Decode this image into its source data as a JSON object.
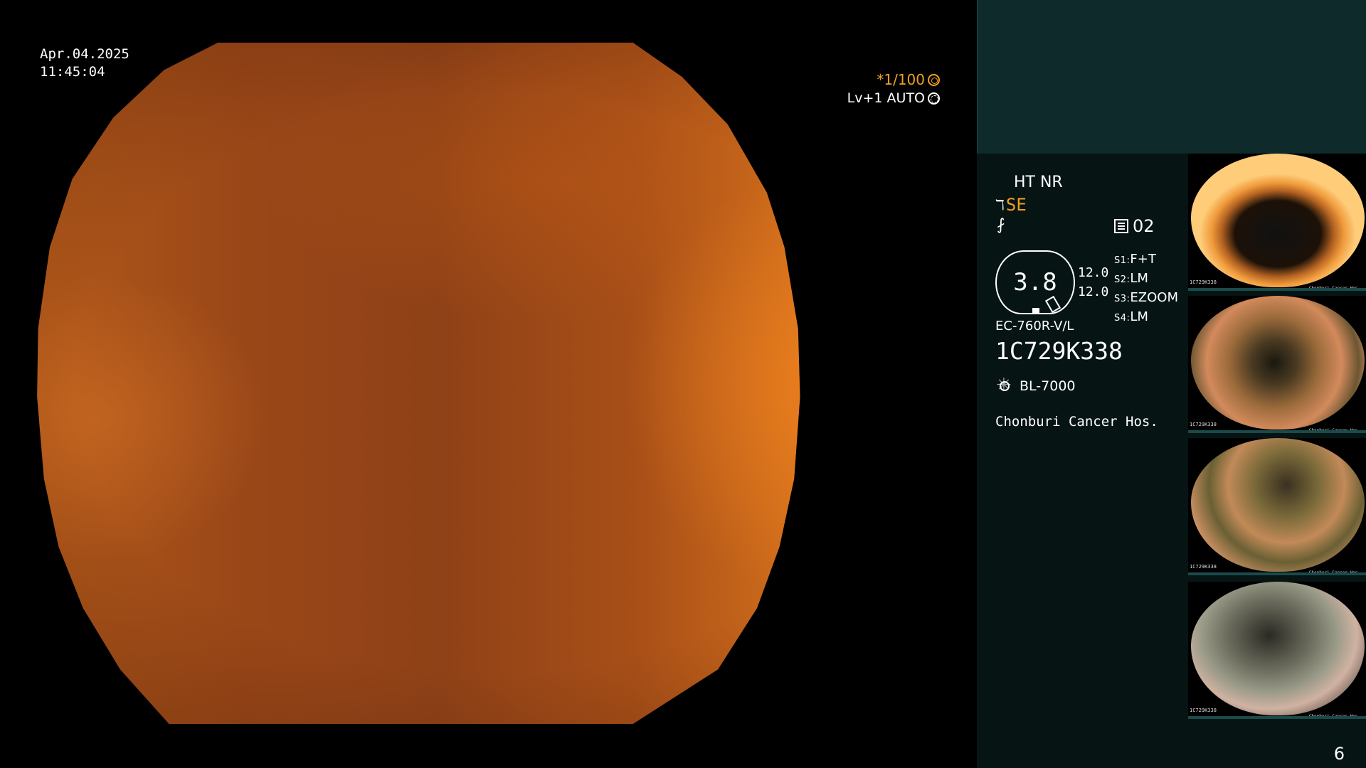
{
  "overlay": {
    "date": "Apr.04.2025",
    "time": "11:45:04",
    "shutter": "*1/100",
    "exposure": "Lv+1 AUTO"
  },
  "status": {
    "ht_nr": "HT NR",
    "se": "SE",
    "f_symbol": "⨏",
    "mode_number": "02",
    "zoom": "3.8",
    "focus_top": "12.0",
    "focus_bottom": "12.0",
    "switches": [
      {
        "key": "S1:",
        "value": "F+T"
      },
      {
        "key": "S2:",
        "value": "LM"
      },
      {
        "key": "S3:",
        "value": "EZOOM"
      },
      {
        "key": "S4:",
        "value": "LM"
      }
    ],
    "scope_model": "EC-760R-V/L",
    "serial": "1C729K338",
    "light_source": "BL-7000",
    "hospital": "Chonburi Cancer Hos."
  },
  "thumbnails": [
    {
      "label": "1C729K338",
      "footer": "Chonburi Cancer Hos."
    },
    {
      "label": "1C729K338",
      "footer": "Chonburi Cancer Hos."
    },
    {
      "label": "1C729K338",
      "footer": "Chonburi Cancer Hos."
    },
    {
      "label": "1C729K338",
      "footer": "Chonburi Cancer Hos."
    }
  ],
  "page_number": "6",
  "colors": {
    "accent": "#f0a020",
    "panel": "#061414",
    "panel_top": "#0e2a2a"
  }
}
